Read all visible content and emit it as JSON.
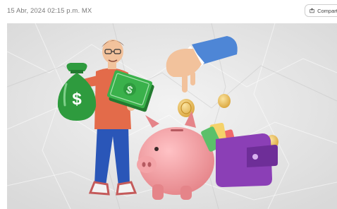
{
  "article": {
    "timestamp": "15 Abr, 2024 02:15 p.m. MX"
  },
  "toolbar": {
    "share_label": "Compartir"
  },
  "hero": {
    "icon": "savings-illustration",
    "colors": {
      "background": "#e6e6e6",
      "piggy_bank": "#f4a4a8",
      "money_green": "#2e9b3e",
      "wallet_purple": "#8b3fb6",
      "coin_gold": "#e5b84a",
      "sleeve_blue": "#4e86d6"
    }
  }
}
